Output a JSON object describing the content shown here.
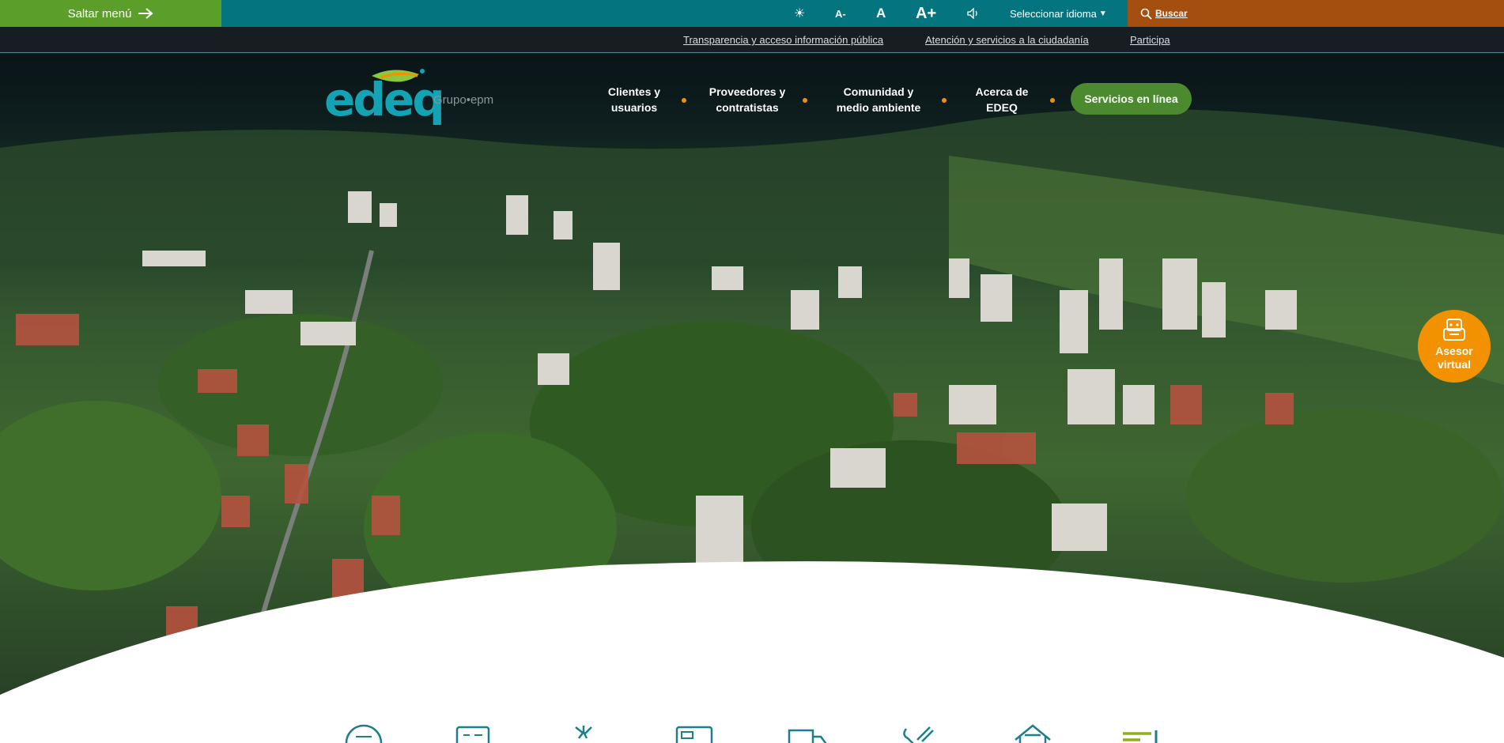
{
  "topbar": {
    "skip_label": "Saltar menú",
    "font_decrease": "A-",
    "font_normal": "A",
    "font_increase": "A+",
    "language_label": "Seleccionar idioma",
    "search_label": "Buscar"
  },
  "links": {
    "transparency": "Transparencia y acceso información pública",
    "attention": "Atención y servicios a la ciudadanía",
    "participate": "Participa"
  },
  "brand": {
    "logo_text": "edeq",
    "group_text": "Grupo•epm"
  },
  "nav": {
    "items": [
      {
        "line1": "Clientes y",
        "line2": "usuarios"
      },
      {
        "line1": "Proveedores y",
        "line2": "contratistas"
      },
      {
        "line1": "Comunidad y",
        "line2": "medio ambiente"
      },
      {
        "line1": "Acerca de",
        "line2": "EDEQ"
      }
    ],
    "cta": "Servicios en línea"
  },
  "assistant": {
    "line1": "Asesor",
    "line2": "virtual"
  },
  "icons": [
    "contrast-icon",
    "volume-icon",
    "search-icon",
    "arrow-right-icon",
    "chat-bot-icon",
    "bill-icon",
    "invoice-icon",
    "energy-icon",
    "payment-card-icon",
    "truck-icon",
    "tools-icon",
    "house-icon",
    "menu-list-icon"
  ],
  "colors": {
    "top_bar": "#04757f",
    "skip": "#5c9e2a",
    "search": "#a44f10",
    "link_bar": "#161e22",
    "cta": "#4b8a2e",
    "accent_orange": "#f39200",
    "logo": "#14a3b5"
  }
}
